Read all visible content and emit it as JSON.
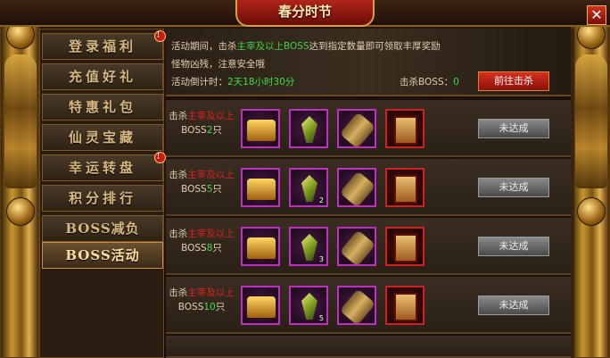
{
  "window": {
    "title": "春分时节",
    "close_label": "✕"
  },
  "sidebar": {
    "items": [
      {
        "label": "登录福利",
        "badge": "!"
      },
      {
        "label": "充值好礼",
        "badge": ""
      },
      {
        "label": "特惠礼包",
        "badge": ""
      },
      {
        "label": "仙灵宝藏",
        "badge": ""
      },
      {
        "label": "幸运转盘",
        "badge": "!"
      },
      {
        "label": "积分排行",
        "badge": ""
      },
      {
        "label": "BOSS减负",
        "badge": ""
      },
      {
        "label": "BOSS活动",
        "badge": ""
      }
    ],
    "active_index": 7
  },
  "info": {
    "line1_prefix": "活动期间，击杀",
    "line1_highlight": "主宰及以上BOSS",
    "line1_suffix": "达到指定数量即可领取丰厚奖励",
    "line2": "怪物凶残，注意安全哦",
    "countdown_label": "活动倒计时：",
    "countdown_value": "2天18小时30分",
    "boss_label": "击杀BOSS：",
    "boss_value": "0",
    "go_button": "前往击杀"
  },
  "rows": [
    {
      "prefix": "击杀",
      "highlight": "主宰及以上",
      "suffix": "BOSS",
      "count": "2",
      "unit": "只",
      "qty": [
        "",
        "",
        "",
        ""
      ],
      "status": "未达成"
    },
    {
      "prefix": "击杀",
      "highlight": "主宰及以上",
      "suffix": "BOSS",
      "count": "5",
      "unit": "只",
      "qty": [
        "",
        "2",
        "",
        ""
      ],
      "status": "未达成"
    },
    {
      "prefix": "击杀",
      "highlight": "主宰及以上",
      "suffix": "BOSS",
      "count": "8",
      "unit": "只",
      "qty": [
        "",
        "3",
        "",
        ""
      ],
      "status": "未达成"
    },
    {
      "prefix": "击杀",
      "highlight": "主宰及以上",
      "suffix": "BOSS",
      "count": "10",
      "unit": "只",
      "qty": [
        "",
        "5",
        "",
        ""
      ],
      "status": "未达成"
    }
  ],
  "item_icons": [
    "treasure-chest-icon",
    "gem-crystal-icon",
    "scroll-icon",
    "skill-book-icon"
  ]
}
